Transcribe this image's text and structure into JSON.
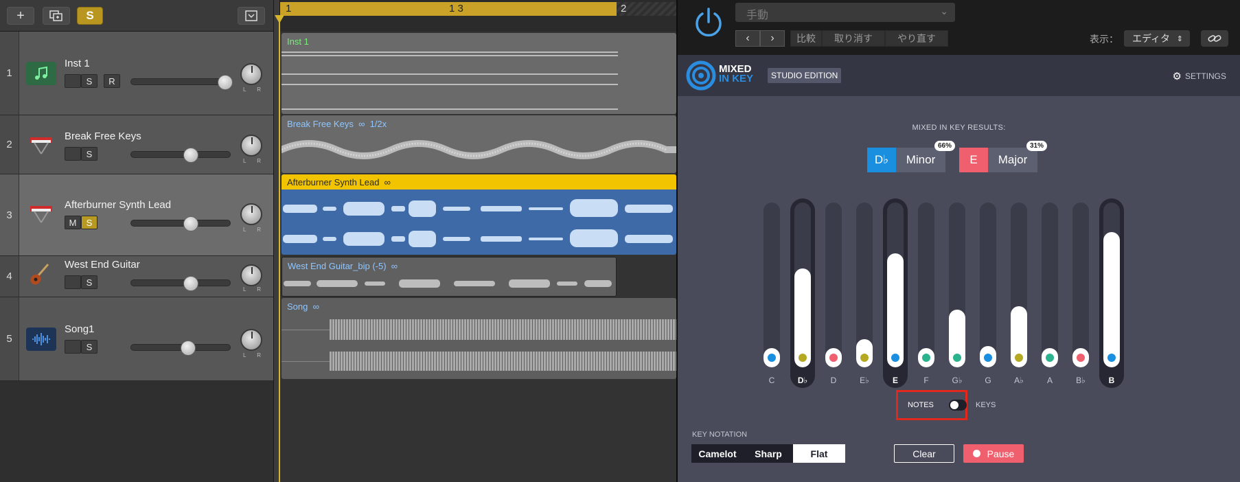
{
  "daw": {
    "toolbar": {
      "add_glyph": "+",
      "solo_label": "S"
    },
    "ruler": {
      "bar1": "1",
      "bar13": "1 3",
      "bar2": "2"
    },
    "tracks": [
      {
        "number": "1",
        "name": "Inst 1",
        "buttons": [
          "",
          "S",
          "R"
        ]
      },
      {
        "number": "2",
        "name": "Break Free Keys",
        "buttons": [
          "",
          "S"
        ]
      },
      {
        "number": "3",
        "name": "Afterburner Synth Lead",
        "buttons": [
          "M",
          "S"
        ]
      },
      {
        "number": "4",
        "name": "West End Guitar",
        "buttons": [
          "",
          "S"
        ]
      },
      {
        "number": "5",
        "name": "Song1",
        "buttons": [
          "",
          "S"
        ]
      }
    ],
    "pan_l": "L",
    "pan_r": "R",
    "regions": [
      {
        "label": "Inst 1"
      },
      {
        "label": "Break Free Keys",
        "extra": "1/2x"
      },
      {
        "label": "Afterburner Synth Lead"
      },
      {
        "label": "West End Guitar_bip (-5)"
      },
      {
        "label": "Song"
      }
    ]
  },
  "plugin": {
    "host": {
      "preset": "手動",
      "compare": "比較",
      "undo": "取り消す",
      "redo": "やり直す",
      "view_label": "表示：",
      "view_value": "エディタ"
    },
    "brand": {
      "line1": "MIXED",
      "line2": "IN KEY",
      "edition": "STUDIO EDITION",
      "settings": "SETTINGS"
    },
    "results": {
      "title": "MIXED IN KEY RESULTS:",
      "keys": [
        {
          "root": "D♭",
          "mode": "Minor",
          "percent": "66%",
          "color": "#1a8fe0"
        },
        {
          "root": "E",
          "mode": "Major",
          "percent": "31%",
          "color": "#ef5f6e"
        }
      ]
    },
    "notes": [
      {
        "name": "C",
        "level": 0.05,
        "dot": "#1a8fe0",
        "highlight": false
      },
      {
        "name": "D♭",
        "level": 0.6,
        "dot": "#b5a823",
        "highlight": true
      },
      {
        "name": "D",
        "level": 0.05,
        "dot": "#ef5f6e",
        "highlight": false
      },
      {
        "name": "E♭",
        "level": 0.17,
        "dot": "#b5a823",
        "highlight": false
      },
      {
        "name": "E",
        "level": 0.69,
        "dot": "#1a8fe0",
        "highlight": true
      },
      {
        "name": "F",
        "level": 0.07,
        "dot": "#2bb38d",
        "highlight": false
      },
      {
        "name": "G♭",
        "level": 0.35,
        "dot": "#2bb38d",
        "highlight": false
      },
      {
        "name": "G",
        "level": 0.13,
        "dot": "#1a8fe0",
        "highlight": false
      },
      {
        "name": "A♭",
        "level": 0.37,
        "dot": "#b5a823",
        "highlight": false
      },
      {
        "name": "A",
        "level": 0.05,
        "dot": "#2bb38d",
        "highlight": false
      },
      {
        "name": "B♭",
        "level": 0.05,
        "dot": "#ef5f6e",
        "highlight": false
      },
      {
        "name": "B",
        "level": 0.82,
        "dot": "#1a8fe0",
        "highlight": true
      }
    ],
    "toggle": {
      "left": "NOTES",
      "right": "KEYS"
    },
    "notation": {
      "label": "KEY NOTATION",
      "options": [
        "Camelot",
        "Sharp",
        "Flat"
      ],
      "selected": "Flat"
    },
    "clear_label": "Clear",
    "pause_label": "Pause"
  }
}
